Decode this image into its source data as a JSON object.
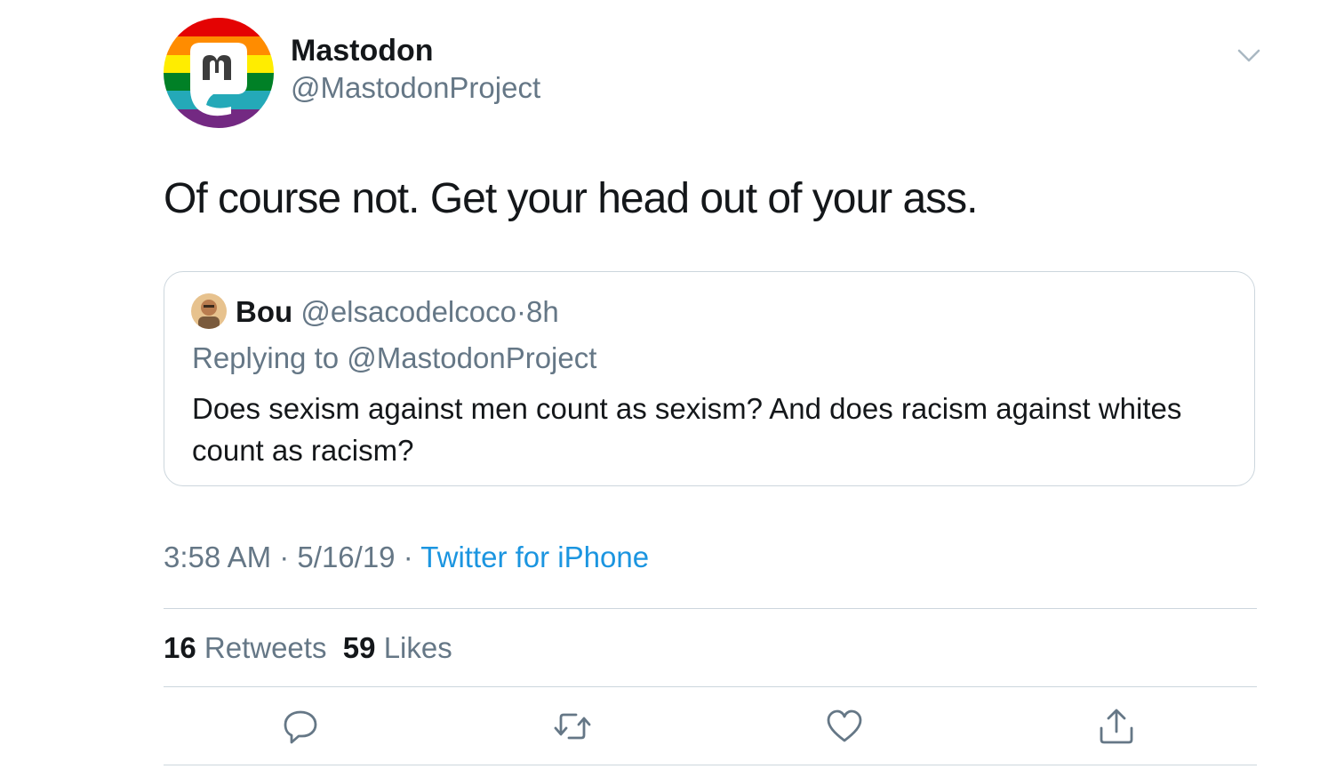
{
  "tweet": {
    "author_name": "Mastodon",
    "author_handle": "@MastodonProject",
    "text": "Of course not. Get your head out of your ass.",
    "time": "3:58 AM",
    "date": "5/16/19",
    "source": "Twitter for iPhone",
    "separator": "·"
  },
  "quoted": {
    "name": "Bou",
    "handle": "@elsacodelcoco",
    "age": "8h",
    "replying_to": "Replying to @MastodonProject",
    "text": "Does sexism against men count as sexism? And does racism against whites count as racism?"
  },
  "stats": {
    "retweets_count": "16",
    "retweets_label": "Retweets",
    "likes_count": "59",
    "likes_label": "Likes"
  },
  "icons": {
    "reply": "reply-icon",
    "retweet": "retweet-icon",
    "like": "heart-icon",
    "share": "share-icon",
    "menu": "chevron-down-icon"
  },
  "colors": {
    "text": "#14171a",
    "secondary": "#657786",
    "link": "#1b95e0",
    "border": "#ccd6dd"
  }
}
